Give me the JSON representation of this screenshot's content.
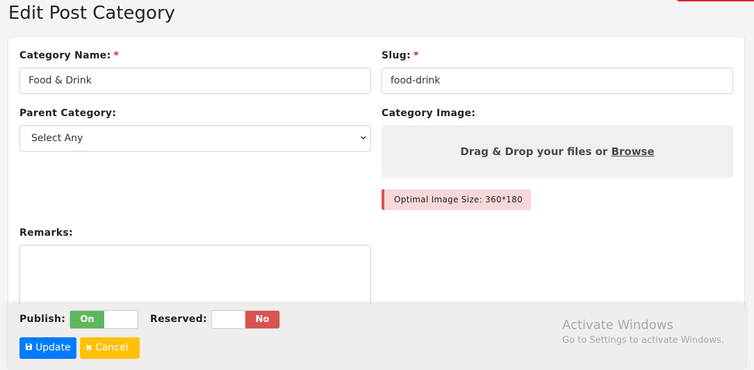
{
  "page": {
    "title": "Edit Post Category"
  },
  "form": {
    "category_name": {
      "label": "Category Name:",
      "required_mark": "*",
      "value": "Food & Drink"
    },
    "slug": {
      "label": "Slug:",
      "required_mark": "*",
      "value": "food-drink"
    },
    "parent_category": {
      "label": "Parent Category:",
      "selected": "Select Any"
    },
    "category_image": {
      "label": "Category Image:",
      "dropzone_text": "Drag & Drop your files or",
      "browse_label": "Browse",
      "hint": "Optimal Image Size: 360*180"
    },
    "remarks": {
      "label": "Remarks:",
      "value": ""
    }
  },
  "footer": {
    "publish": {
      "label": "Publish:",
      "state": "On",
      "on_color": "#5cb85c"
    },
    "reserved": {
      "label": "Reserved:",
      "state": "No",
      "off_color": "#d9534f"
    },
    "update_label": "Update",
    "cancel_label": "Cancel",
    "update_color": "#007bff",
    "cancel_color": "#ffc107"
  },
  "watermark": {
    "line1": "Activate Windows",
    "line2": "Go to Settings to activate Windows."
  }
}
